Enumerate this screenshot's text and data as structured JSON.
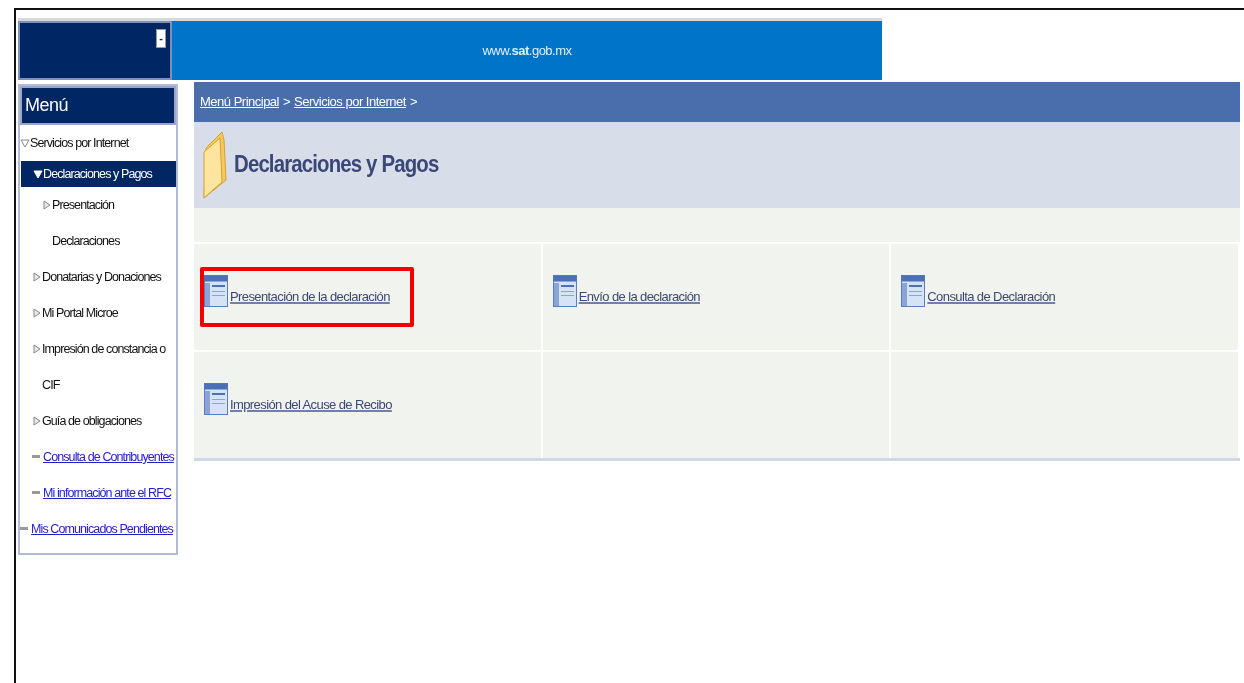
{
  "header": {
    "site": "www.**sat**.gob.mx",
    "collapse_symbol": "-"
  },
  "sidebar": {
    "title": "Menú",
    "items": [
      {
        "kind": "folder",
        "label": "Servicios por Internet",
        "expanded": true,
        "selected": false,
        "children": [
          {
            "kind": "folder",
            "label": "Declaraciones y Pagos",
            "expanded": true,
            "selected": true,
            "children": [
              {
                "kind": "folder",
                "label": "Presentación Declaraciones",
                "expanded": false,
                "selected": false
              }
            ]
          },
          {
            "kind": "folder",
            "label": "Donatarias y Donaciones",
            "expanded": false,
            "selected": false
          },
          {
            "kind": "folder",
            "label": "Mi Portal Microe",
            "expanded": false,
            "selected": false
          },
          {
            "kind": "folder",
            "label": "Impresión de constancia o CIF",
            "expanded": false,
            "selected": false
          },
          {
            "kind": "folder",
            "label": "Guía de obligaciones",
            "expanded": false,
            "selected": false
          },
          {
            "kind": "link",
            "label": "Consulta de Contribuyentes",
            "selected": false
          },
          {
            "kind": "link",
            "label": "Mi información ante el RFC",
            "selected": false
          }
        ]
      },
      {
        "kind": "link",
        "label": "Mis Comunicados Pendientes",
        "selected": false
      }
    ]
  },
  "breadcrumb": [
    "Menú Principal",
    "Servicios por Internet"
  ],
  "breadcrumb_separator": ">",
  "page_title": "Declaraciones y Pagos",
  "tiles": [
    {
      "label": "Presentación de la declaración",
      "highlighted": true
    },
    {
      "label": "Envío de la declaración",
      "highlighted": false
    },
    {
      "label": "Consulta de Declaración",
      "highlighted": false
    },
    {
      "label": "Impresión del Acuse de Recibo",
      "highlighted": false
    }
  ]
}
